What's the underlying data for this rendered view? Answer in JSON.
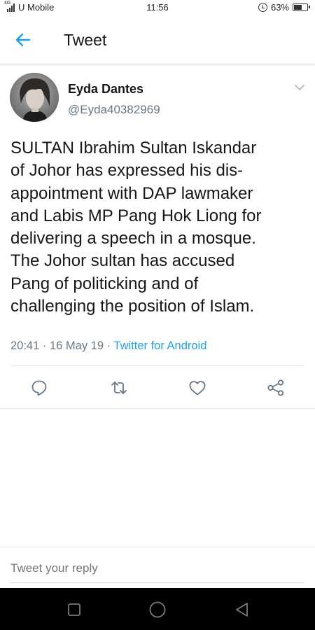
{
  "status_bar": {
    "network_type": "4G",
    "carrier": "U Mobile",
    "time": "11:56",
    "battery_percent": "63%",
    "battery_level": 0.63,
    "icons": [
      "signal-icon",
      "alarm-icon",
      "battery-icon"
    ]
  },
  "header": {
    "title": "Tweet",
    "back_icon": "arrow-left-icon",
    "accent_color": "#1da1f2"
  },
  "tweet": {
    "author_name": "Eyda Dantes",
    "author_handle": "@Eyda40382969",
    "text": "SULTAN Ibrahim Sultan Iskandar\nof Johor has expressed his dis-\nappointment with DAP lawmaker\nand Labis MP Pang Hok Liong for\ndelivering a speech in a mosque.\nThe Johor sultan has accused\nPang of politicking and of\nchallenging the position of Islam.",
    "time": "20:41",
    "separator": "·",
    "date": "16 May 19",
    "source": "Twitter for Android",
    "actions": [
      "reply-icon",
      "retweet-icon",
      "like-icon",
      "share-icon"
    ]
  },
  "reply": {
    "placeholder": "Tweet your reply"
  },
  "nav_bar": {
    "buttons": [
      "recents-square-icon",
      "home-circle-icon",
      "back-triangle-icon"
    ]
  }
}
